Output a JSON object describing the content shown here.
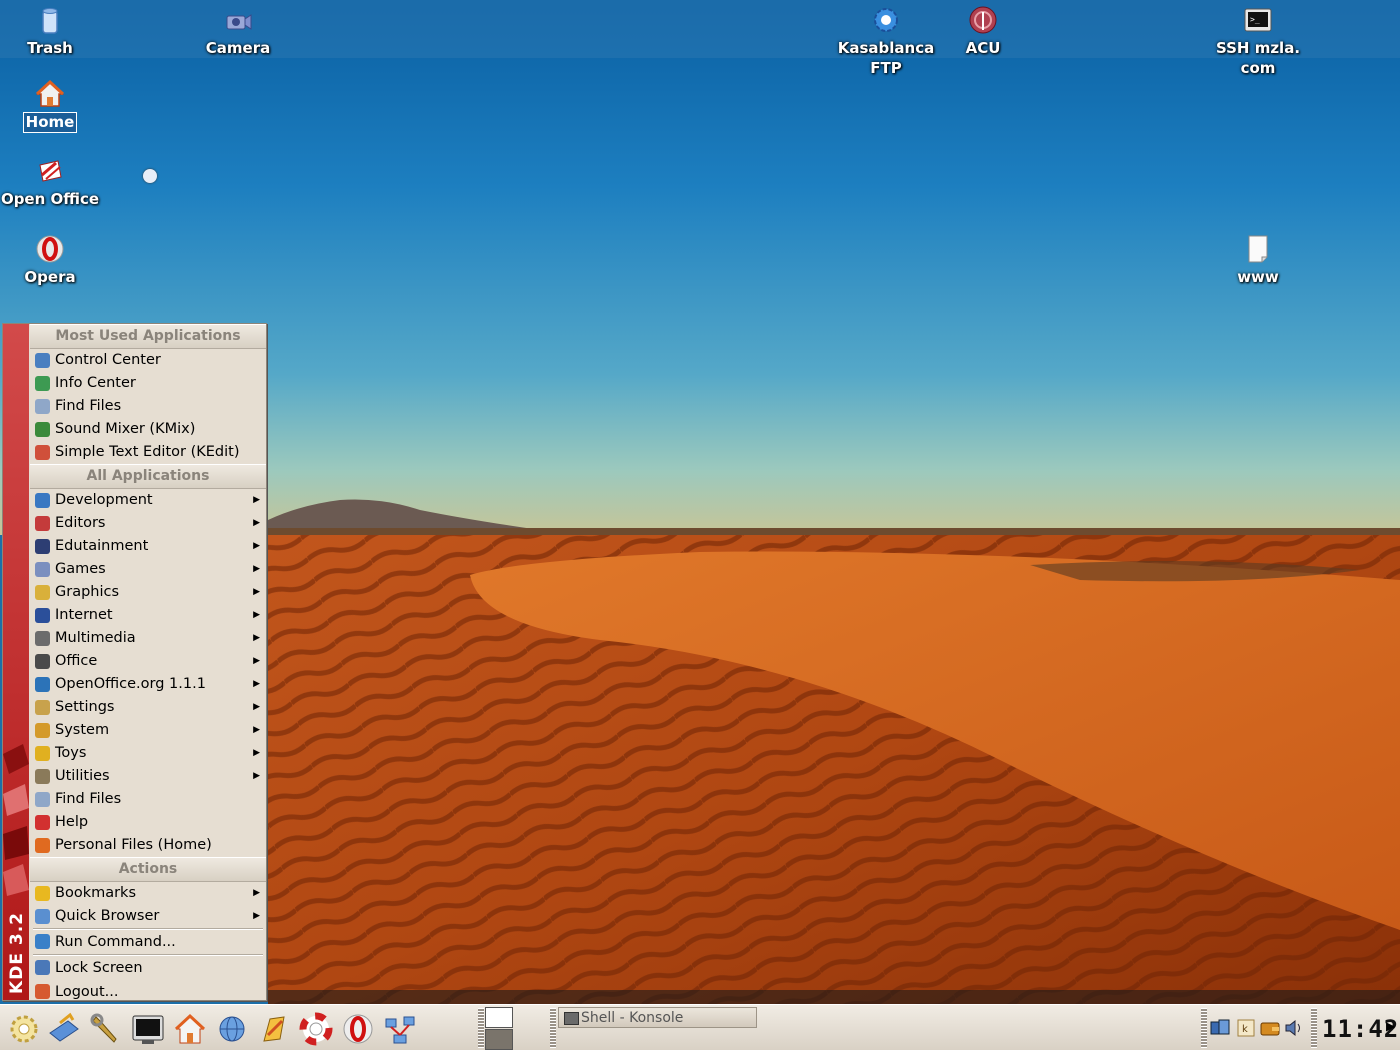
{
  "desktop": {
    "icons": [
      {
        "id": "trash",
        "label": "Trash",
        "icon": "trash-icon"
      },
      {
        "id": "camera",
        "label": "Camera",
        "icon": "camera-icon"
      },
      {
        "id": "kasablanca",
        "label": "Kasablanca FTP",
        "line1": "Kasablanca",
        "line2": "FTP",
        "icon": "gear-icon"
      },
      {
        "id": "acu",
        "label": "ACU",
        "icon": "antenna-icon"
      },
      {
        "id": "ssh",
        "label": "SSH mzla.com",
        "line1": "SSH mzla.",
        "line2": "com",
        "icon": "terminal-icon"
      },
      {
        "id": "home",
        "label": "Home",
        "icon": "home-icon",
        "selected": true
      },
      {
        "id": "openoffice",
        "label": "Open Office",
        "icon": "openoffice-icon"
      },
      {
        "id": "opera",
        "label": "Opera",
        "icon": "opera-icon"
      },
      {
        "id": "www",
        "label": "www",
        "icon": "document-icon"
      }
    ]
  },
  "kmenu": {
    "brand": "KDE 3.2",
    "sections": {
      "most_used": "Most Used Applications",
      "all_apps": "All Applications",
      "actions": "Actions"
    },
    "most_used": [
      {
        "label": "Control Center",
        "icon": "control-center-icon",
        "color": "#4a7fc0"
      },
      {
        "label": "Info Center",
        "icon": "info-center-icon",
        "color": "#3d9a52"
      },
      {
        "label": "Find Files",
        "icon": "find-files-icon",
        "color": "#8fa7c8"
      },
      {
        "label": "Sound Mixer (KMix)",
        "icon": "sound-mixer-icon",
        "color": "#3b8a3b"
      },
      {
        "label": "Simple Text Editor (KEdit)",
        "icon": "text-editor-icon",
        "color": "#d0503a"
      }
    ],
    "all_apps": [
      {
        "label": "Development",
        "icon": "development-icon",
        "color": "#3a78c2",
        "submenu": true
      },
      {
        "label": "Editors",
        "icon": "editors-icon",
        "color": "#c43b3b",
        "submenu": true
      },
      {
        "label": "Edutainment",
        "icon": "edutainment-icon",
        "color": "#2d3e73",
        "submenu": true
      },
      {
        "label": "Games",
        "icon": "games-icon",
        "color": "#7b8fbf",
        "submenu": true
      },
      {
        "label": "Graphics",
        "icon": "graphics-icon",
        "color": "#d9b03a",
        "submenu": true
      },
      {
        "label": "Internet",
        "icon": "internet-icon",
        "color": "#2b4f9a",
        "submenu": true
      },
      {
        "label": "Multimedia",
        "icon": "multimedia-icon",
        "color": "#6c6c6c",
        "submenu": true
      },
      {
        "label": "Office",
        "icon": "office-icon",
        "color": "#4a4a4a",
        "submenu": true
      },
      {
        "label": "OpenOffice.org 1.1.1",
        "icon": "openoffice-menu-icon",
        "color": "#2c73b8",
        "submenu": true
      },
      {
        "label": "Settings",
        "icon": "settings-icon",
        "color": "#c8a24c",
        "submenu": true
      },
      {
        "label": "System",
        "icon": "system-icon",
        "color": "#d49a2a",
        "submenu": true
      },
      {
        "label": "Toys",
        "icon": "toys-icon",
        "color": "#e0b020",
        "submenu": true
      },
      {
        "label": "Utilities",
        "icon": "utilities-icon",
        "color": "#8a7a5a",
        "submenu": true
      },
      {
        "label": "Find Files",
        "icon": "find-files-icon",
        "color": "#8fa7c8",
        "submenu": false
      },
      {
        "label": "Help",
        "icon": "help-icon",
        "color": "#d23030",
        "submenu": false
      },
      {
        "label": "Personal Files (Home)",
        "icon": "home-icon",
        "color": "#e06a20",
        "submenu": false
      }
    ],
    "actions": [
      {
        "label": "Bookmarks",
        "icon": "bookmarks-icon",
        "color": "#e8b820",
        "submenu": true
      },
      {
        "label": "Quick Browser",
        "icon": "quick-browser-icon",
        "color": "#5a8fd0",
        "submenu": true
      },
      {
        "label": "Run Command...",
        "icon": "run-command-icon",
        "color": "#3a80c8",
        "submenu": false
      },
      {
        "label": "Lock Screen",
        "icon": "lock-screen-icon",
        "color": "#4a78b8",
        "submenu": false
      },
      {
        "label": "Logout...",
        "icon": "logout-icon",
        "color": "#d65a30",
        "submenu": false
      }
    ]
  },
  "panel": {
    "launchers": [
      {
        "name": "kmenu-launcher",
        "icon": "kde-gear-icon"
      },
      {
        "name": "desktop-launcher",
        "icon": "show-desktop-icon"
      },
      {
        "name": "control-center-launcher",
        "icon": "wrench-icon"
      },
      {
        "name": "konsole-launcher",
        "icon": "terminal-icon"
      },
      {
        "name": "home-launcher",
        "icon": "home-icon"
      },
      {
        "name": "konqueror-launcher",
        "icon": "globe-icon"
      },
      {
        "name": "kword-launcher",
        "icon": "editor-icon"
      },
      {
        "name": "help-launcher",
        "icon": "lifebuoy-icon"
      },
      {
        "name": "opera-launcher",
        "icon": "opera-icon"
      },
      {
        "name": "network-launcher",
        "icon": "network-icon"
      }
    ],
    "taskbar": [
      {
        "label": "Shell - Konsole",
        "icon": "konsole-icon"
      }
    ],
    "tray": [
      {
        "name": "network-tray",
        "icon": "network-monitor-icon"
      },
      {
        "name": "keyboard-tray",
        "icon": "keyboard-layout-icon"
      },
      {
        "name": "wallet-tray",
        "icon": "wallet-icon"
      },
      {
        "name": "volume-tray",
        "icon": "speaker-icon"
      }
    ],
    "clock": "11:42"
  }
}
